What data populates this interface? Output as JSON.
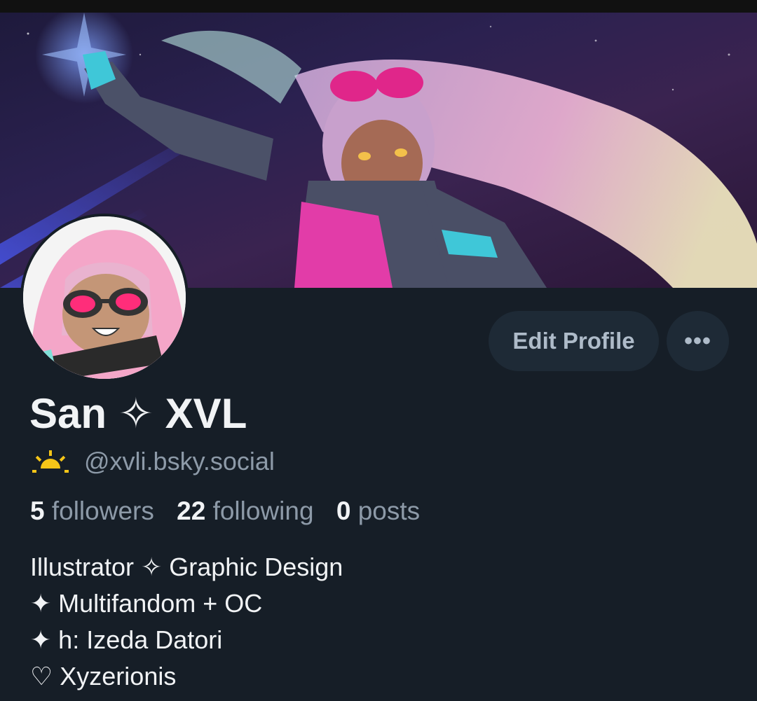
{
  "profile": {
    "display_name": "San ✧ XVL",
    "handle": "@xvli.bsky.social",
    "handle_icon": "sun-icon",
    "stats": {
      "followers_count": "5",
      "followers_label": "followers",
      "following_count": "22",
      "following_label": "following",
      "posts_count": "0",
      "posts_label": "posts"
    },
    "bio": [
      "Illustrator ✧ Graphic Design",
      "✦ Multifandom + OC",
      "✦ h: Izeda Datori",
      "♡ Xyzerionis"
    ]
  },
  "actions": {
    "edit_label": "Edit Profile",
    "more_label": "•••"
  },
  "colors": {
    "background": "#161e27",
    "button_bg": "#1e2a36",
    "text_primary": "#f1f3f5",
    "text_secondary": "#8d9aa8",
    "sun_icon": "#f5c518"
  }
}
